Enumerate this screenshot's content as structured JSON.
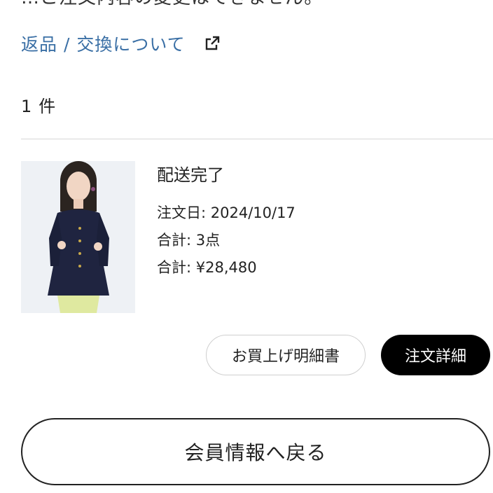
{
  "notice_text_clipped": "…こ注文内容の変更はできません。",
  "returns_link": {
    "label": "返品 / 交換について",
    "icon": "external-link-icon"
  },
  "order_count": {
    "number": "1",
    "unit": "件"
  },
  "order": {
    "status": "配送完了",
    "order_date": "注文日: 2024/10/17",
    "total_items": "合計: 3点",
    "total_price": "合計: ¥28,480"
  },
  "buttons": {
    "receipt": "お買上げ明細書",
    "detail": "注文詳細",
    "back": "会員情報へ戻る"
  },
  "colors": {
    "link": "#3a6fa5",
    "primary_button_bg": "#000000",
    "divider": "#d6d6d6"
  }
}
